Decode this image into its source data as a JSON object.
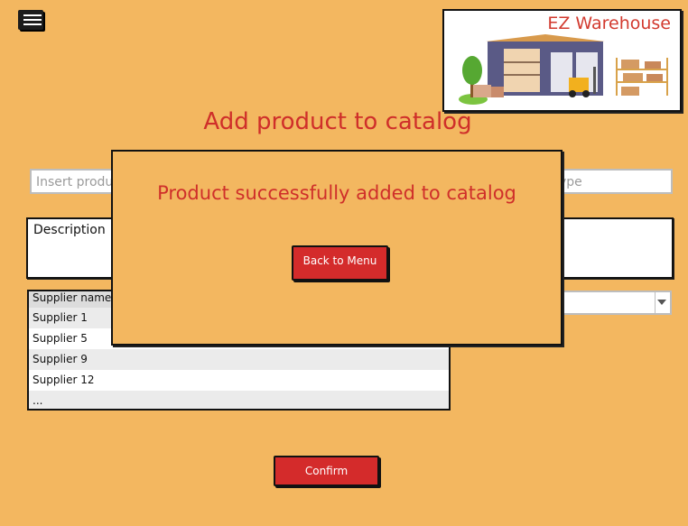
{
  "app": {
    "name": "EZ Warehouse"
  },
  "page": {
    "title": "Add product to catalog"
  },
  "form": {
    "product_placeholder": "Insert produ",
    "type_placeholder": "ype",
    "description_label": "Description",
    "confirm_label": "Confirm"
  },
  "suppliers": {
    "column_header": "Supplier name",
    "rows": [
      "Supplier 1",
      "Supplier 5",
      "Supplier 9",
      "Supplier 12",
      "..."
    ]
  },
  "modal": {
    "message": "Product successfully added to catalog",
    "back_label": "Back to Menu"
  },
  "icons": {
    "menu": "hamburger-menu-icon",
    "logo": "warehouse-illustration"
  },
  "colors": {
    "background": "#f3b760",
    "accent": "#d42b2b",
    "title": "#cf2f2a"
  }
}
